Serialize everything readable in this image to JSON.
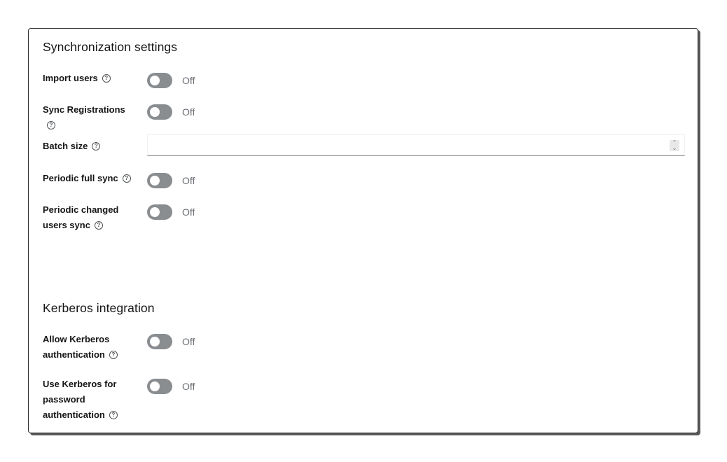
{
  "sync": {
    "title": "Synchronization settings",
    "import_users": {
      "label": "Import users",
      "state": "Off"
    },
    "sync_registrations": {
      "label": "Sync Registrations",
      "state": "Off"
    },
    "batch_size": {
      "label": "Batch size",
      "value": "",
      "placeholder": ""
    },
    "periodic_full_sync": {
      "label": "Periodic full sync",
      "state": "Off"
    },
    "periodic_changed": {
      "label_line1": "Periodic changed",
      "label_line2": "users sync",
      "state": "Off"
    }
  },
  "kerberos": {
    "title": "Kerberos integration",
    "allow_auth": {
      "label_line1": "Allow Kerberos",
      "label_line2": "authentication",
      "state": "Off"
    },
    "use_for_password": {
      "label_line1": "Use Kerberos for",
      "label_line2": "password",
      "label_line3": "authentication",
      "state": "Off"
    }
  },
  "icons": {
    "help": "?",
    "spinner": "⌃⌄"
  },
  "colors": {
    "switch_off": "#8a8d90",
    "switch_text": "#6a6e73",
    "frame_border": "#2b2b2b"
  }
}
